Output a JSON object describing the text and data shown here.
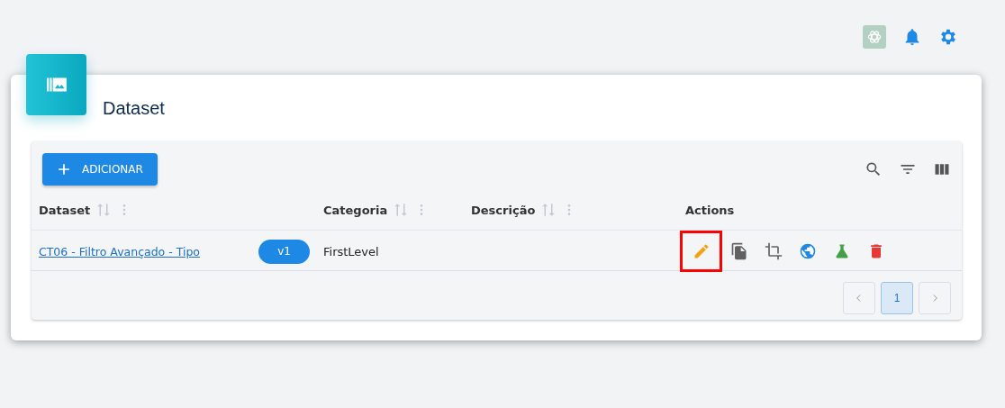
{
  "page": {
    "title": "Dataset"
  },
  "toolbar": {
    "add_button": "ADICIONAR"
  },
  "table": {
    "columns": [
      {
        "label": "Dataset",
        "sortable": true
      },
      {
        "label": "Categoria",
        "sortable": true
      },
      {
        "label": "Descrição",
        "sortable": true
      },
      {
        "label": "Actions",
        "sortable": false
      }
    ],
    "rows": [
      {
        "dataset": "CT06 - Filtro Avançado - Tipo",
        "version": "v1",
        "categoria": "FirstLevel",
        "actions": [
          {
            "kind": "edit",
            "highlighted": true
          },
          {
            "kind": "copy",
            "highlighted": false
          },
          {
            "kind": "crop",
            "highlighted": false
          },
          {
            "kind": "globe",
            "highlighted": false
          },
          {
            "kind": "flask",
            "highlighted": false
          },
          {
            "kind": "delete",
            "highlighted": false
          }
        ]
      }
    ]
  },
  "pagination": {
    "pages": [
      {
        "label": "1",
        "selected": true
      }
    ]
  }
}
